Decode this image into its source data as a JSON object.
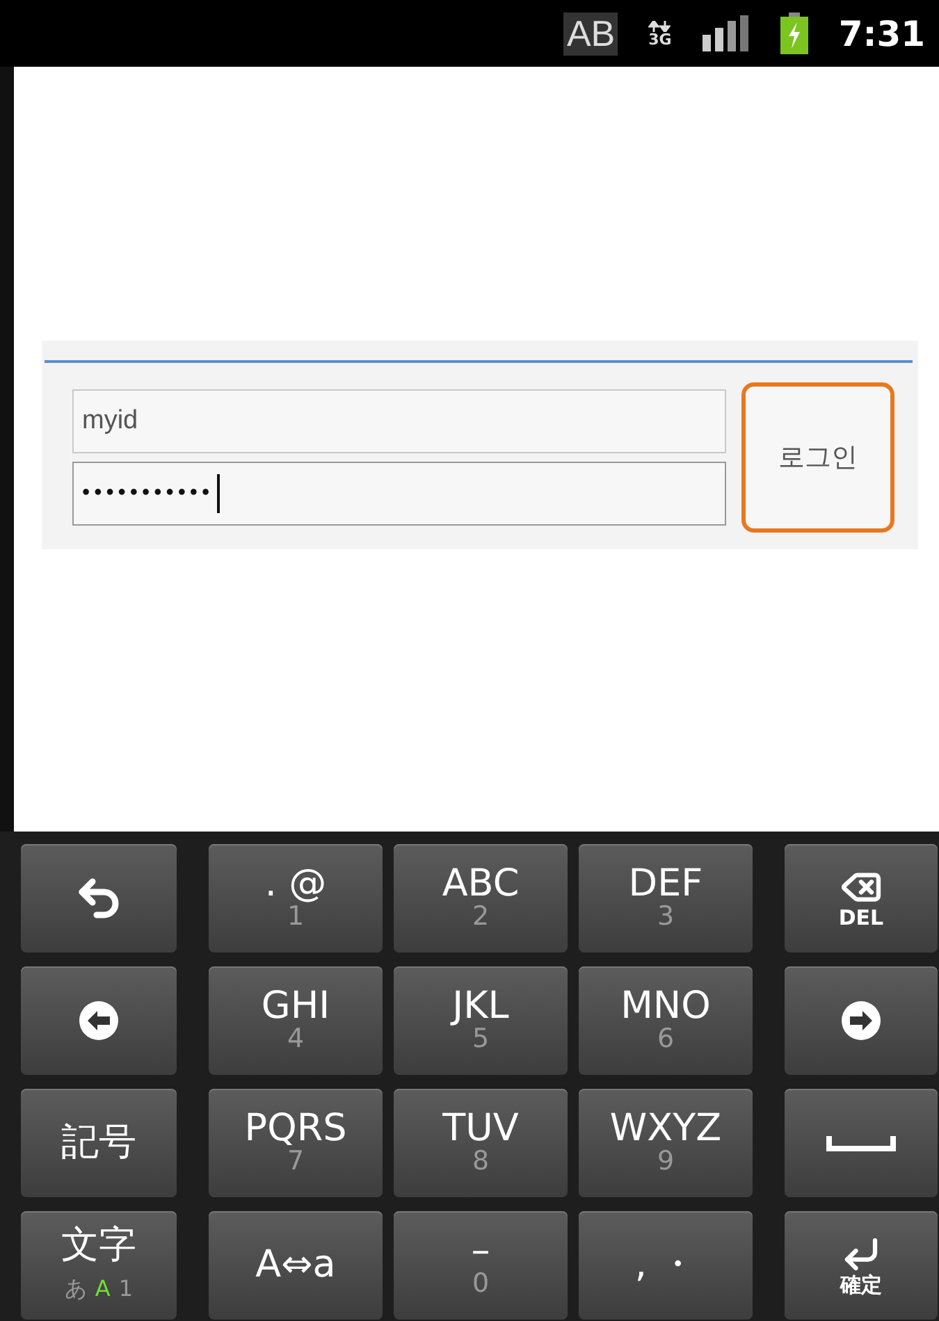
{
  "status_bar": {
    "input_mode": "AB",
    "network": "3G",
    "time": "7:31"
  },
  "login_form": {
    "username": {
      "value": "myid"
    },
    "password": {
      "value": "•••••••••••",
      "focused": true
    },
    "login_button": {
      "label": "로그인",
      "focused": true
    }
  },
  "keyboard": {
    "rows": [
      [
        {
          "kind": "back"
        },
        {
          "kind": "letters",
          "main": ". @",
          "sub": "1"
        },
        {
          "kind": "letters",
          "main": "ABC",
          "sub": "2"
        },
        {
          "kind": "letters",
          "main": "DEF",
          "sub": "3"
        },
        {
          "kind": "backspace",
          "label": "DEL"
        }
      ],
      [
        {
          "kind": "left"
        },
        {
          "kind": "letters",
          "main": "GHI",
          "sub": "4"
        },
        {
          "kind": "letters",
          "main": "JKL",
          "sub": "5"
        },
        {
          "kind": "letters",
          "main": "MNO",
          "sub": "6"
        },
        {
          "kind": "right"
        }
      ],
      [
        {
          "kind": "text",
          "main": "記号"
        },
        {
          "kind": "letters",
          "main": "PQRS",
          "sub": "7"
        },
        {
          "kind": "letters",
          "main": "TUV",
          "sub": "8"
        },
        {
          "kind": "letters",
          "main": "WXYZ",
          "sub": "9"
        },
        {
          "kind": "space"
        }
      ],
      [
        {
          "kind": "mode",
          "main": "文字",
          "modes": [
            {
              "label": "あ",
              "selected": false
            },
            {
              "label": "A",
              "selected": true
            },
            {
              "label": "1",
              "selected": false
            }
          ]
        },
        {
          "kind": "text",
          "main": "A⇔a"
        },
        {
          "kind": "letters",
          "main": "–",
          "sub": "0"
        },
        {
          "kind": "text",
          "main": ",   ・"
        },
        {
          "kind": "enter",
          "label": "確定"
        }
      ]
    ]
  }
}
